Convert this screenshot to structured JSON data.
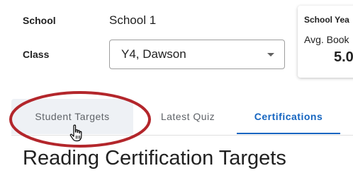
{
  "filters": {
    "school_label": "School",
    "school_value": "School 1",
    "class_label": "Class",
    "class_value": "Y4, Dawson"
  },
  "card": {
    "title": "School Yea",
    "metric_label": "Avg. Book",
    "metric_value": "5.0"
  },
  "tabs": [
    {
      "label": "Student Targets"
    },
    {
      "label": "Latest Quiz"
    },
    {
      "label": "Certifications"
    }
  ],
  "active_tab": "Certifications",
  "heading": "Reading Certification Targets",
  "colors": {
    "accent": "#1565c0",
    "annotation": "#b3262b",
    "hover_tab_bg": "#eef1f5"
  },
  "icons": {
    "dropdown": "arrow-drop-down-icon",
    "cursor": "hand-pointer-icon"
  }
}
